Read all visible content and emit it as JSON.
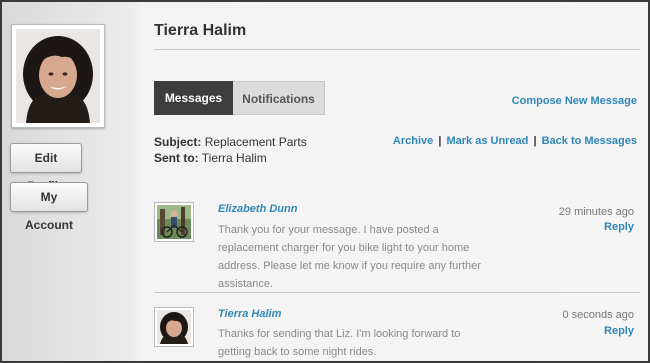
{
  "sidebar": {
    "edit_profile_label": "Edit Profile",
    "my_account_label": "My Account"
  },
  "header": {
    "user_name": "Tierra Halim"
  },
  "tabs": [
    {
      "label": "Messages",
      "active": true
    },
    {
      "label": "Notifications",
      "active": false
    }
  ],
  "compose_label": "Compose New Message",
  "message_meta": {
    "subject_label": "Subject:",
    "subject_value": "Replacement Parts",
    "sentto_label": "Sent to:",
    "sentto_value": "Tierra Halim"
  },
  "actions": {
    "archive": "Archive",
    "mark_unread": "Mark as Unread",
    "back": "Back to Messages",
    "separator": "|"
  },
  "messages": [
    {
      "author": "Elizabeth Dunn",
      "time": "29 minutes ago",
      "reply": "Reply",
      "body_lines": [
        "Thank you for your message. I have posted a",
        "replacement charger for you bike light to your home",
        "address. Please let me know if you require any further",
        "assistance."
      ]
    },
    {
      "author": "Tierra Halim",
      "time": "0 seconds ago",
      "reply": "Reply",
      "body_lines": [
        "Thanks for sending that Liz. I'm looking forward to",
        "getting back to some night rides."
      ]
    }
  ],
  "colors": {
    "link": "#2f87b8",
    "active_tab": "#3d3d3d",
    "inactive_tab": "#dcdcdc"
  }
}
